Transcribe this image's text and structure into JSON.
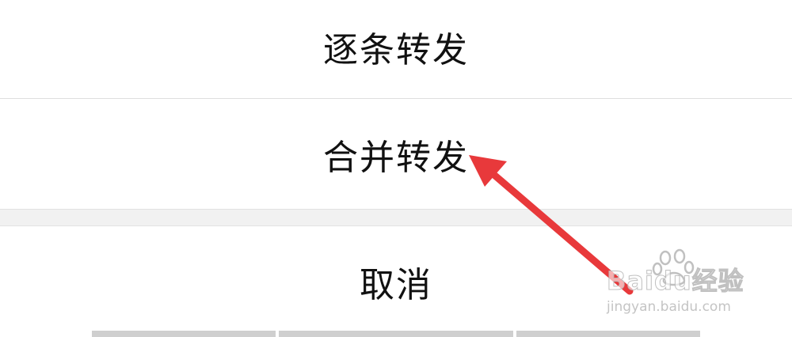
{
  "menu": {
    "forward_one_by_one": "逐条转发",
    "merge_forward": "合并转发",
    "cancel": "取消"
  },
  "watermark": {
    "logo": "Baidu经验",
    "url": "jingyan.baidu.com"
  },
  "colors": {
    "arrow": "#e8393b",
    "text": "#111111",
    "divider": "#dedede",
    "gap": "#f1f1f1"
  },
  "icons": [
    "red-arrow-annotation",
    "baidu-paw-icon"
  ]
}
